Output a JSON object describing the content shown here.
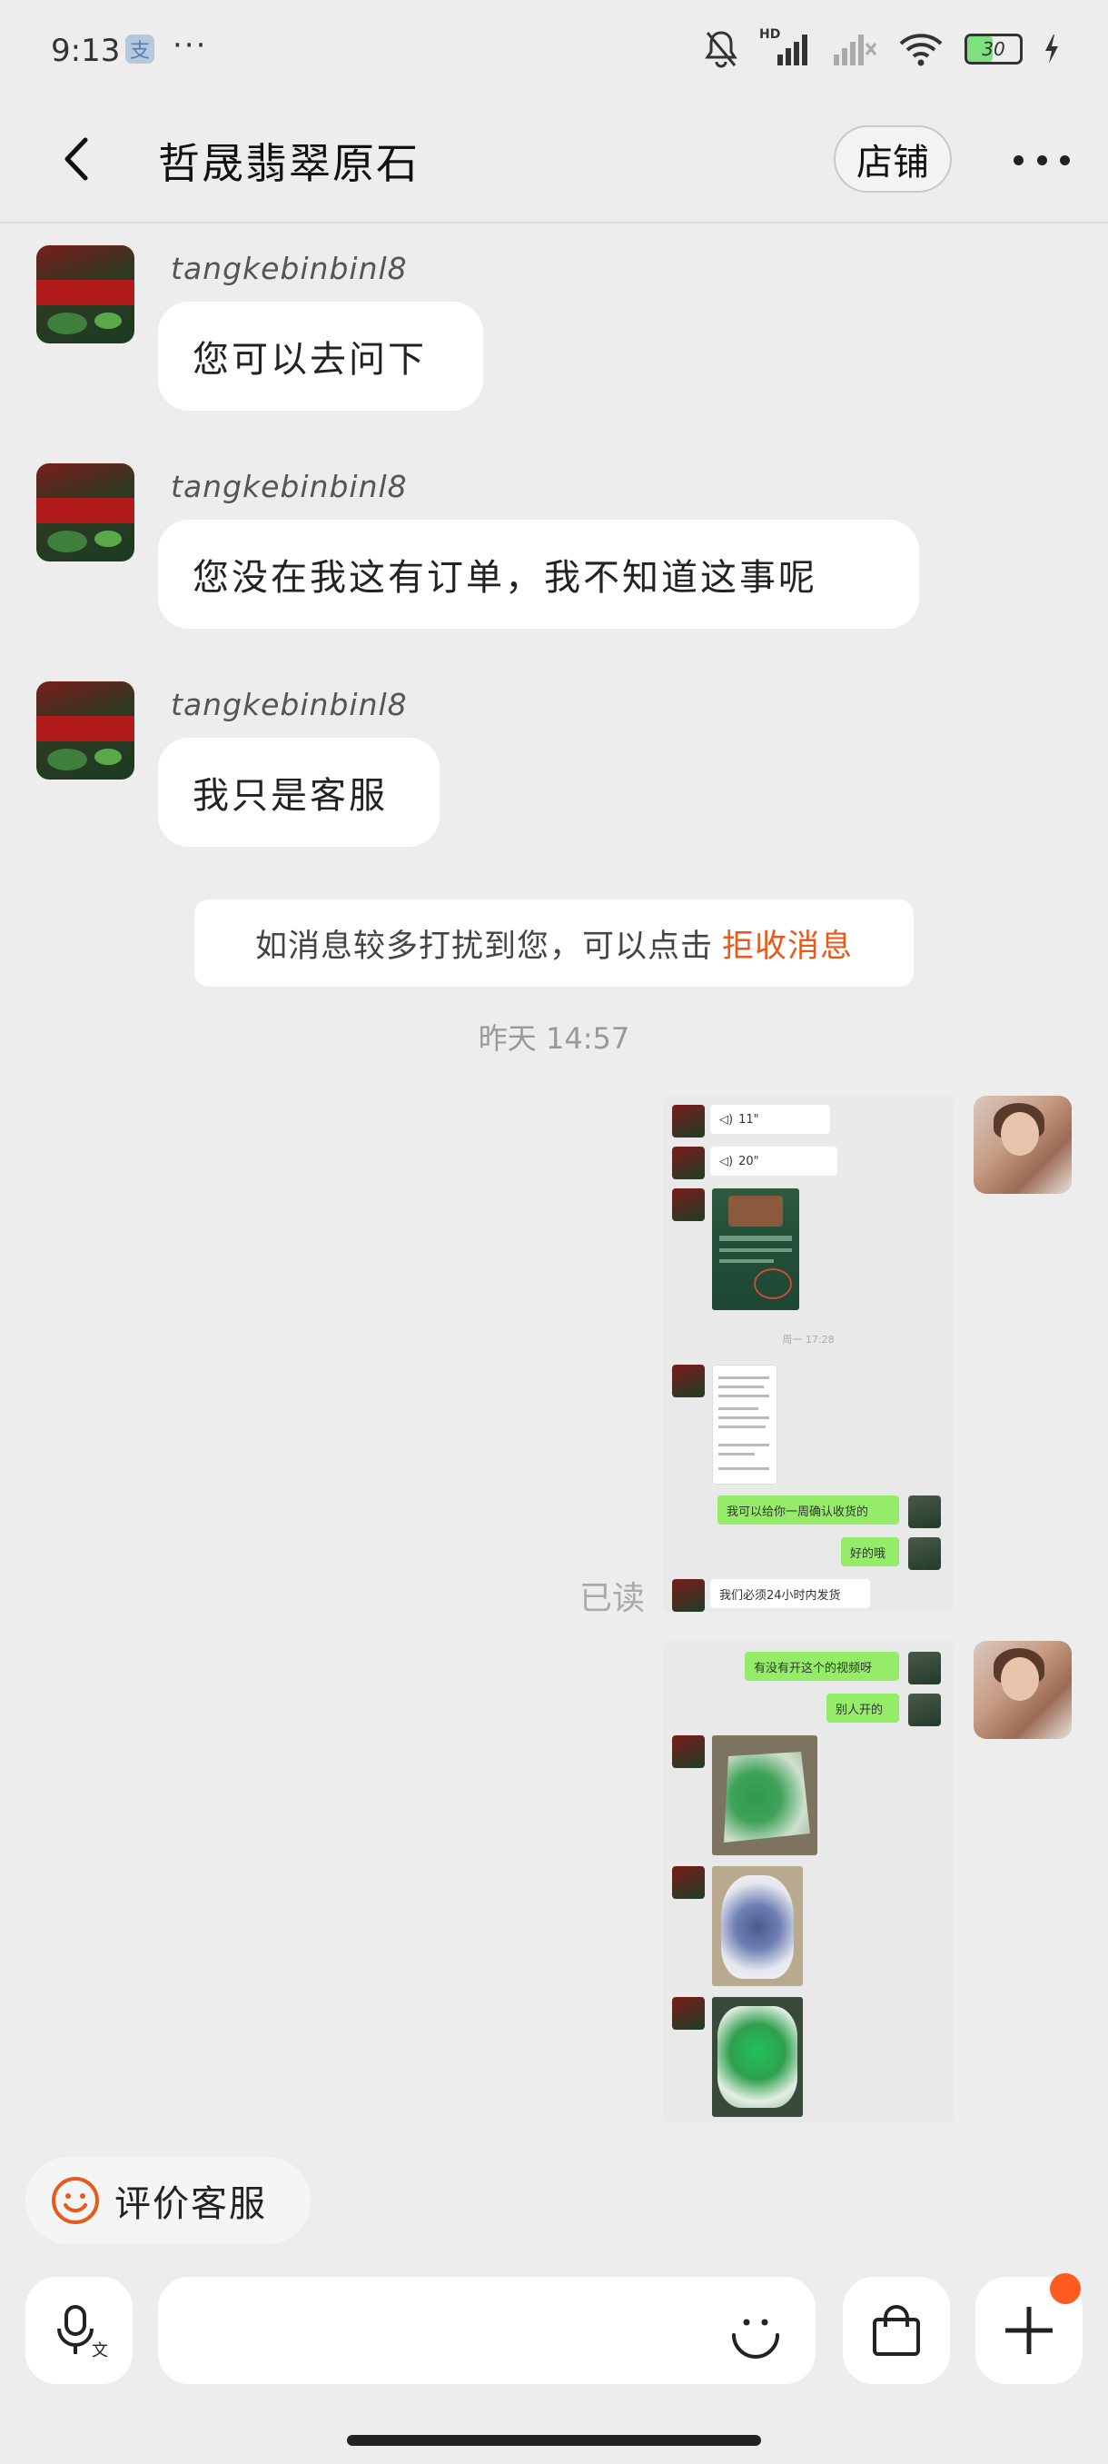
{
  "status_bar": {
    "time": "9:13",
    "alipay_glyph": "支",
    "overflow": "···",
    "network_label": "HD",
    "battery_level": "30"
  },
  "header": {
    "title": "哲晟翡翠原石",
    "shop_label": "店铺"
  },
  "messages": [
    {
      "sender": "tangkebinbinl8",
      "text": "您可以去问下"
    },
    {
      "sender": "tangkebinbinl8",
      "text": "您没在我这有订单，我不知道这事呢"
    },
    {
      "sender": "tangkebinbinl8",
      "text": "我只是客服"
    }
  ],
  "notice": {
    "text": "如消息较多打扰到您，可以点击",
    "link": "拒收消息"
  },
  "timestamp": "昨天 14:57",
  "screenshot_1": {
    "voice_1": "11\"",
    "voice_2": "20\"",
    "inner_time": "周一 17:28",
    "msg_1": "我可以给你一周确认收货的",
    "msg_2": "好的哦",
    "msg_3": "我们必须24小时内发货"
  },
  "screenshot_2": {
    "msg_1": "有没有开这个的视频呀",
    "msg_2": "别人开的"
  },
  "read_status": "已读",
  "rate_chip": {
    "label": "评价客服"
  },
  "input": {
    "placeholder": ""
  },
  "colors": {
    "accent": "#e85a19",
    "background": "#ededed",
    "outgoing_green": "#95ec69",
    "badge": "#ff5a1f"
  }
}
